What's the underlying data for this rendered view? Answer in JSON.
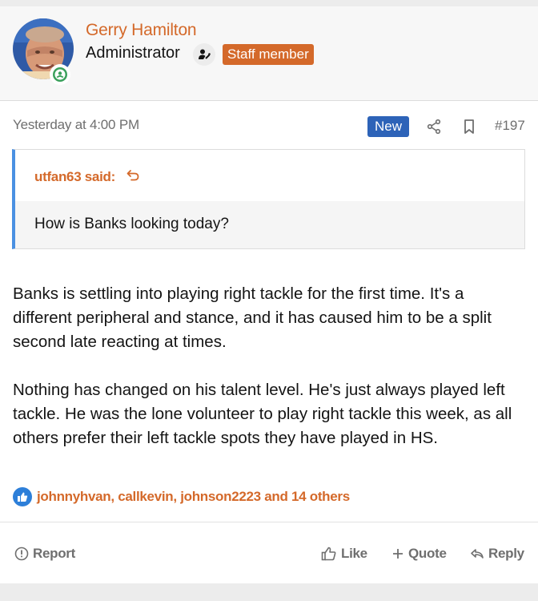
{
  "user": {
    "name": "Gerry Hamilton",
    "title": "Administrator",
    "badge": "Staff member",
    "avatar_icon": "user-photo",
    "status_icon": "online-user-icon"
  },
  "post": {
    "date": "Yesterday at 4:00 PM",
    "new_label": "New",
    "number": "#197",
    "quote": {
      "author": "utfan63 said:",
      "text": "How is Banks looking today?"
    },
    "paragraphs": [
      "Banks is settling into playing right tackle for the first time. It's a different peripheral and stance, and it has caused him to be a split second late reacting at times.",
      "Nothing has changed on his talent level. He's just always played left tackle. He was the lone volunteer to play right tackle this week, as all others prefer their left tackle spots they have played in HS."
    ],
    "reactions": "johnnyhvan, callkevin, johnson2223 and 14 others"
  },
  "actions": {
    "report": "Report",
    "like": "Like",
    "quote": "Quote",
    "reply": "Reply"
  },
  "colors": {
    "accent": "#d4692a",
    "new_badge": "#2d63b8",
    "quote_border": "#4a90e2",
    "online": "#3aa05b"
  }
}
